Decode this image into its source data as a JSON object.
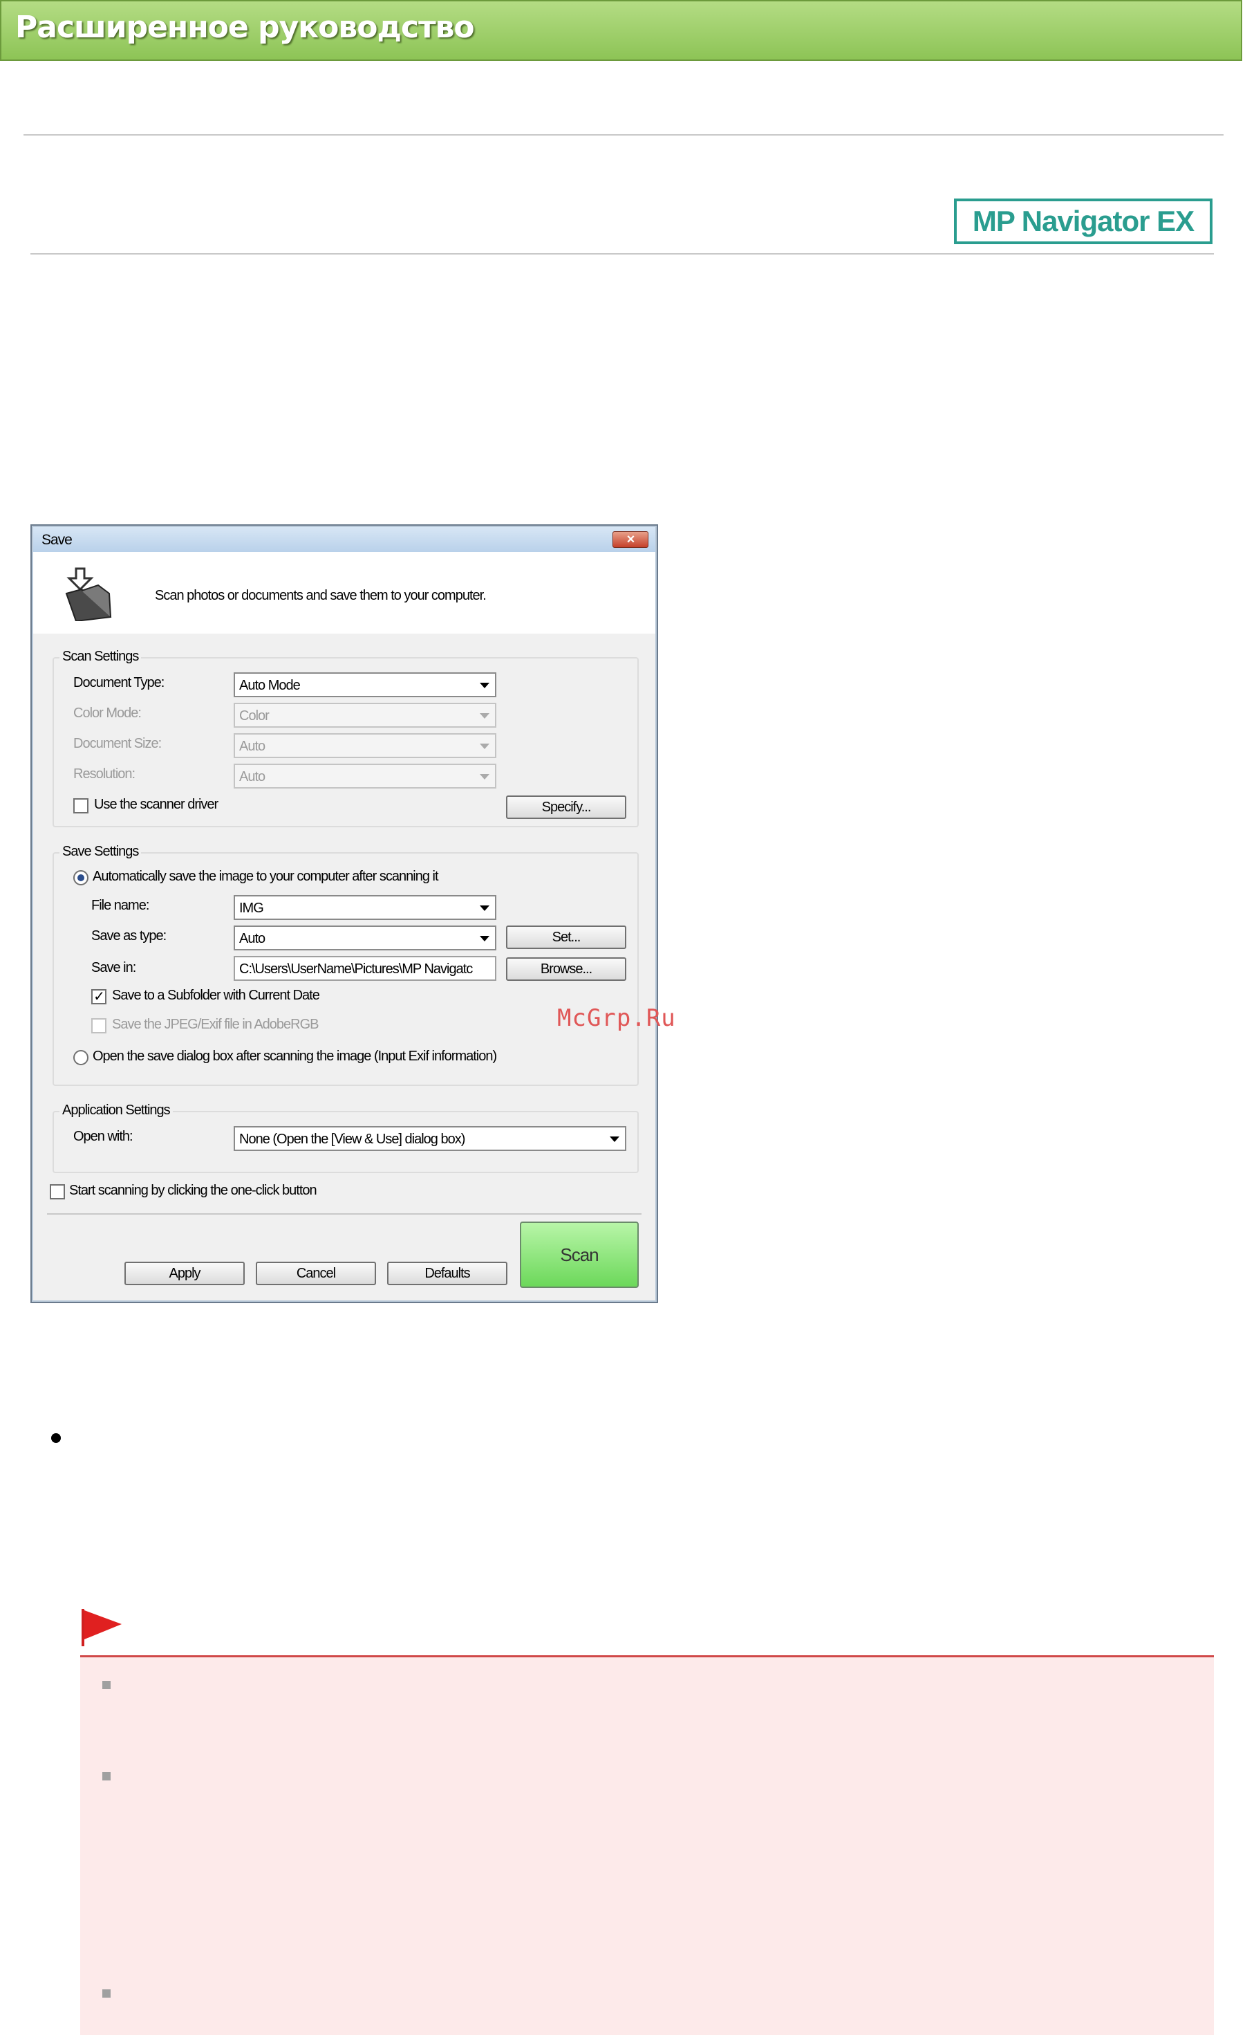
{
  "header": {
    "title": "Расширенное руководство",
    "product_badge": "MP Navigator EX"
  },
  "dialog": {
    "title": "Save",
    "close_symbol": "×",
    "description": "Scan photos or documents and save them to your computer.",
    "scan_settings": {
      "group_title": "Scan Settings",
      "document_type_label": "Document Type:",
      "document_type_value": "Auto Mode",
      "color_mode_label": "Color Mode:",
      "color_mode_value": "Color",
      "document_size_label": "Document Size:",
      "document_size_value": "Auto",
      "resolution_label": "Resolution:",
      "resolution_value": "Auto",
      "use_scanner_driver_label": "Use the scanner driver",
      "use_scanner_driver_checked": false,
      "specify_button": "Specify..."
    },
    "save_settings": {
      "group_title": "Save Settings",
      "auto_save_label": "Automatically save the image to your computer after scanning it",
      "file_name_label": "File name:",
      "file_name_value": "IMG",
      "save_as_type_label": "Save as type:",
      "save_as_type_value": "Auto",
      "set_button": "Set...",
      "save_in_label": "Save in:",
      "save_in_value": "C:\\Users\\UserName\\Pictures\\MP Navigatc",
      "browse_button": "Browse...",
      "subfolder_label": "Save to a Subfolder with Current Date",
      "subfolder_checked_mark": "✓",
      "adobergb_label": "Save the JPEG/Exif file in AdobeRGB",
      "open_dialog_label": "Open the save dialog box after scanning the image (Input Exif information)"
    },
    "application_settings": {
      "group_title": "Application Settings",
      "open_with_label": "Open with:",
      "open_with_value": "None (Open the [View & Use] dialog box)"
    },
    "one_click_label": "Start scanning by clicking the one-click button",
    "buttons": {
      "apply": "Apply",
      "cancel": "Cancel",
      "defaults": "Defaults",
      "scan": "Scan"
    }
  },
  "watermark": "McGrp.Ru",
  "colors": {
    "banner_green": "#8dc456",
    "badge_teal": "#2a9d8f",
    "note_red": "#d04848",
    "note_bg": "#fdeaea",
    "scan_button_green": "#6cd85a"
  }
}
